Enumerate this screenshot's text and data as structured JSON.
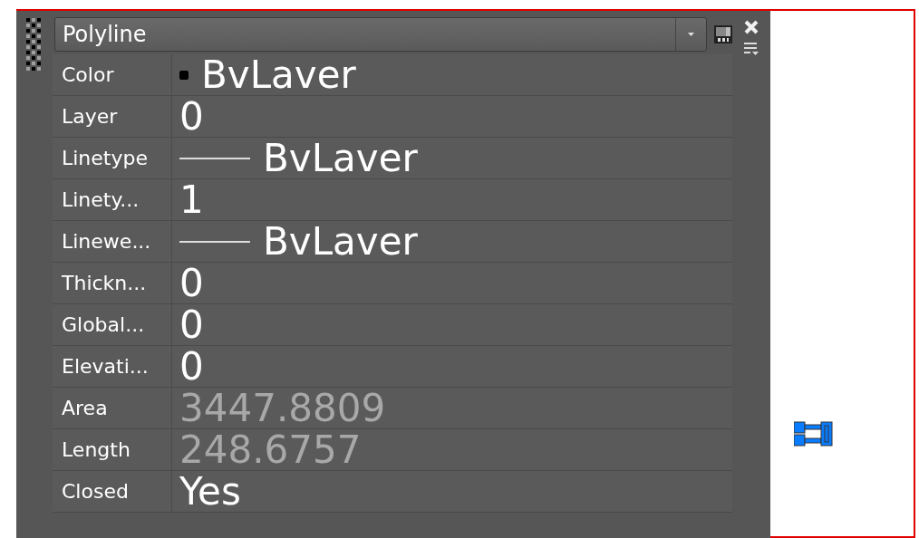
{
  "palette": {
    "title": "Polyline"
  },
  "properties": [
    {
      "label": "Color",
      "value": "BvLaver",
      "kind": "swatch",
      "color": "#000000",
      "disabled": false
    },
    {
      "label": "Layer",
      "value": "0",
      "kind": "plain",
      "disabled": false
    },
    {
      "label": "Linetype",
      "value": "BvLaver",
      "kind": "line",
      "disabled": false
    },
    {
      "label": "Linety...",
      "value": "1",
      "kind": "plain",
      "disabled": false
    },
    {
      "label": "Linewe...",
      "value": "BvLaver",
      "kind": "line",
      "disabled": false
    },
    {
      "label": "Thickn...",
      "value": "0",
      "kind": "plain",
      "disabled": false
    },
    {
      "label": "Global...",
      "value": "0",
      "kind": "plain",
      "disabled": false
    },
    {
      "label": "Elevati...",
      "value": "0",
      "kind": "plain",
      "disabled": false
    },
    {
      "label": "Area",
      "value": "3447.8809",
      "kind": "plain",
      "disabled": true
    },
    {
      "label": "Length",
      "value": "248.6757",
      "kind": "plain",
      "disabled": true
    },
    {
      "label": "Closed",
      "value": "Yes",
      "kind": "plain",
      "disabled": false
    }
  ]
}
